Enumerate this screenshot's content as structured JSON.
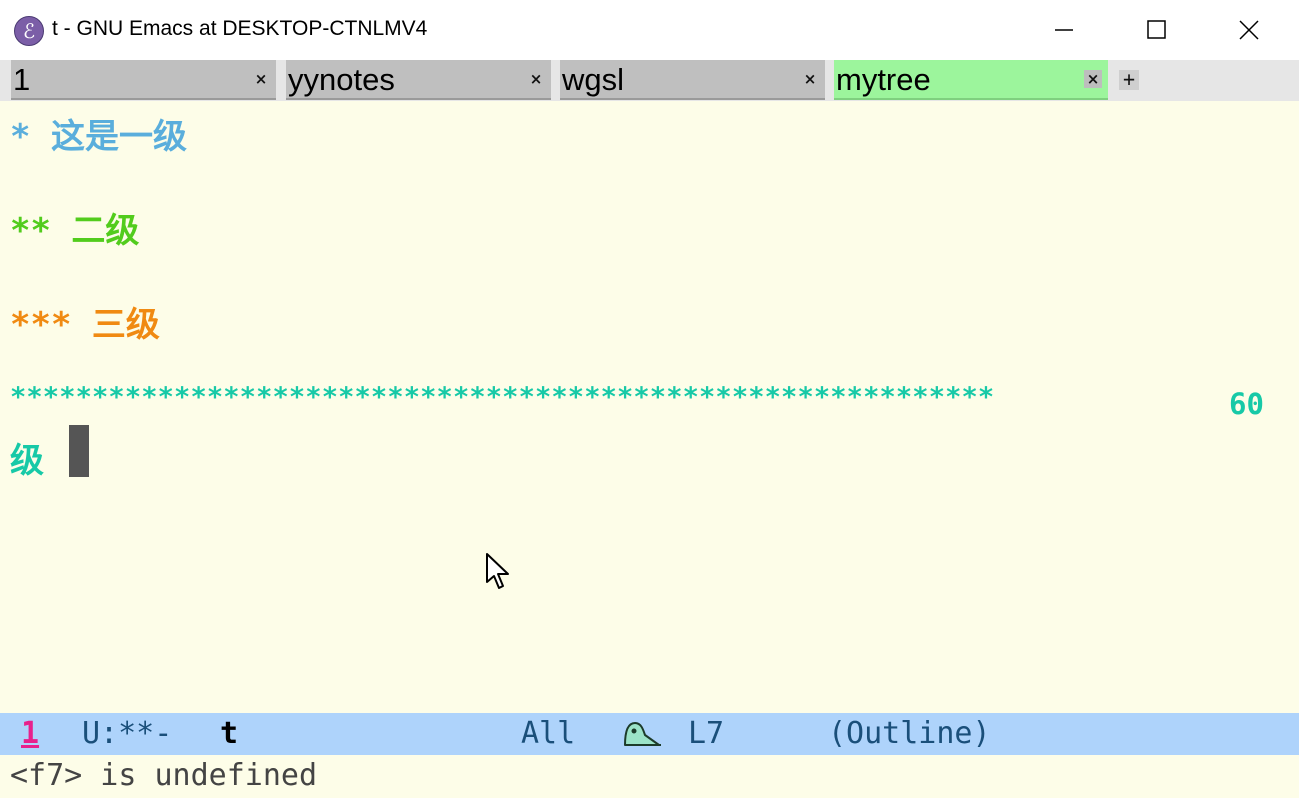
{
  "window": {
    "title": "t - GNU Emacs at DESKTOP-CTNLMV4",
    "icon": "emacs-icon",
    "icon_glyph": "ℰ",
    "controls": [
      "minimize-icon",
      "maximize-icon",
      "close-icon"
    ]
  },
  "tabs": {
    "items": [
      {
        "label": "1",
        "active": false
      },
      {
        "label": "yynotes",
        "active": false
      },
      {
        "label": "wgsl",
        "active": false
      },
      {
        "label": "mytree",
        "active": true
      }
    ],
    "close_glyph": "×",
    "add_glyph": "+"
  },
  "editor": {
    "lines": [
      {
        "text": "* 这是一级",
        "color": "#5aaedc"
      },
      {
        "text": "** 二级",
        "color": "#52cc1c"
      },
      {
        "text": "*** 三级",
        "color": "#f08a12"
      },
      {
        "text": "************************************************************",
        "color": "#17c9a7"
      },
      {
        "text": "级",
        "color": "#17c9a7"
      }
    ],
    "wrap_suffix": "60",
    "background": "#fdfde8"
  },
  "modeline": {
    "window_number": "1",
    "state": "U:**-",
    "buffer": "t",
    "position": "All",
    "line": "L7",
    "mode": "(Outline)",
    "mode_icon": "nyan-icon",
    "background": "#aed3fb"
  },
  "echo": {
    "message": "<f7> is undefined"
  }
}
